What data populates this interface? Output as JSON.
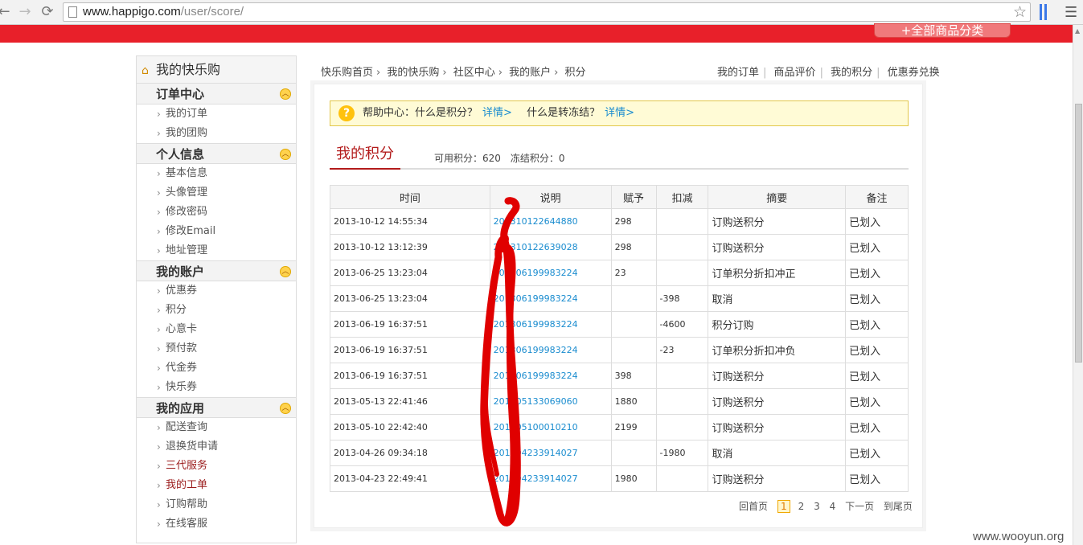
{
  "browser": {
    "url_host": "www.happigo.com",
    "url_path": "/user/score/"
  },
  "header": {
    "all_categories": "+全部商品分类"
  },
  "sidebar": {
    "title": "我的快乐购",
    "sections": [
      {
        "title": "订单中心",
        "items": [
          {
            "label": "我的订单"
          },
          {
            "label": "我的团购"
          }
        ]
      },
      {
        "title": "个人信息",
        "items": [
          {
            "label": "基本信息"
          },
          {
            "label": "头像管理"
          },
          {
            "label": "修改密码"
          },
          {
            "label": "修改Email"
          },
          {
            "label": "地址管理"
          }
        ]
      },
      {
        "title": "我的账户",
        "items": [
          {
            "label": "优惠券"
          },
          {
            "label": "积分"
          },
          {
            "label": "心意卡"
          },
          {
            "label": "预付款"
          },
          {
            "label": "代金券"
          },
          {
            "label": "快乐券"
          }
        ]
      },
      {
        "title": "我的应用",
        "items": [
          {
            "label": "配送查询"
          },
          {
            "label": "退换货申请"
          },
          {
            "label": "三代服务",
            "highlight": true
          },
          {
            "label": "我的工单",
            "highlight": true
          },
          {
            "label": "订购帮助"
          },
          {
            "label": "在线客服"
          }
        ]
      }
    ]
  },
  "breadcrumb": [
    "快乐购首页",
    "我的快乐购",
    "社区中心",
    "我的账户",
    "积分"
  ],
  "toplinks": [
    "我的订单",
    "商品评价",
    "我的积分",
    "优惠券兑换"
  ],
  "help": {
    "q1": "帮助中心：什么是积分？",
    "q1_link": "详情>",
    "q2": "什么是转冻结？",
    "q2_link": "详情>"
  },
  "score": {
    "tab_title": "我的积分",
    "available": "可用积分：620",
    "frozen": "冻结积分：0"
  },
  "table": {
    "headers": [
      "时间",
      "说明",
      "赋予",
      "扣减",
      "摘要",
      "备注"
    ],
    "rows": [
      {
        "time": "2013-10-12 14:55:34",
        "desc": "201310122644880",
        "give": "298",
        "deduct": "",
        "summary": "订购送积分",
        "note": "已划入"
      },
      {
        "time": "2013-10-12 13:12:39",
        "desc": "201310122639028",
        "give": "298",
        "deduct": "",
        "summary": "订购送积分",
        "note": "已划入"
      },
      {
        "time": "2013-06-25 13:23:04",
        "desc": "201306199983224",
        "give": "23",
        "deduct": "",
        "summary": "订单积分折扣冲正",
        "note": "已划入"
      },
      {
        "time": "2013-06-25 13:23:04",
        "desc": "201306199983224",
        "give": "",
        "deduct": "-398",
        "summary": "取消",
        "note": "已划入"
      },
      {
        "time": "2013-06-19 16:37:51",
        "desc": "201306199983224",
        "give": "",
        "deduct": "-4600",
        "summary": "积分订购",
        "note": "已划入"
      },
      {
        "time": "2013-06-19 16:37:51",
        "desc": "201306199983224",
        "give": "",
        "deduct": "-23",
        "summary": "订单积分折扣冲负",
        "note": "已划入"
      },
      {
        "time": "2013-06-19 16:37:51",
        "desc": "201306199983224",
        "give": "398",
        "deduct": "",
        "summary": "订购送积分",
        "note": "已划入"
      },
      {
        "time": "2013-05-13 22:41:46",
        "desc": "201305133069060",
        "give": "1880",
        "deduct": "",
        "summary": "订购送积分",
        "note": "已划入"
      },
      {
        "time": "2013-05-10 22:42:40",
        "desc": "201305100010210",
        "give": "2199",
        "deduct": "",
        "summary": "订购送积分",
        "note": "已划入"
      },
      {
        "time": "2013-04-26 09:34:18",
        "desc": "201304233914027",
        "give": "",
        "deduct": "-1980",
        "summary": "取消",
        "note": "已划入"
      },
      {
        "time": "2013-04-23 22:49:41",
        "desc": "201304233914027",
        "give": "1980",
        "deduct": "",
        "summary": "订购送积分",
        "note": "已划入"
      }
    ]
  },
  "pager": {
    "first": "回首页",
    "pages": [
      "1",
      "2",
      "3",
      "4"
    ],
    "current": "1",
    "next": "下一页",
    "last": "到尾页"
  },
  "watermark": "www.wooyun.org",
  "colors": {
    "brand_red": "#e8202a",
    "link_blue": "#1a8ccf",
    "title_red": "#b31b1b",
    "scribble": "#e00000"
  }
}
